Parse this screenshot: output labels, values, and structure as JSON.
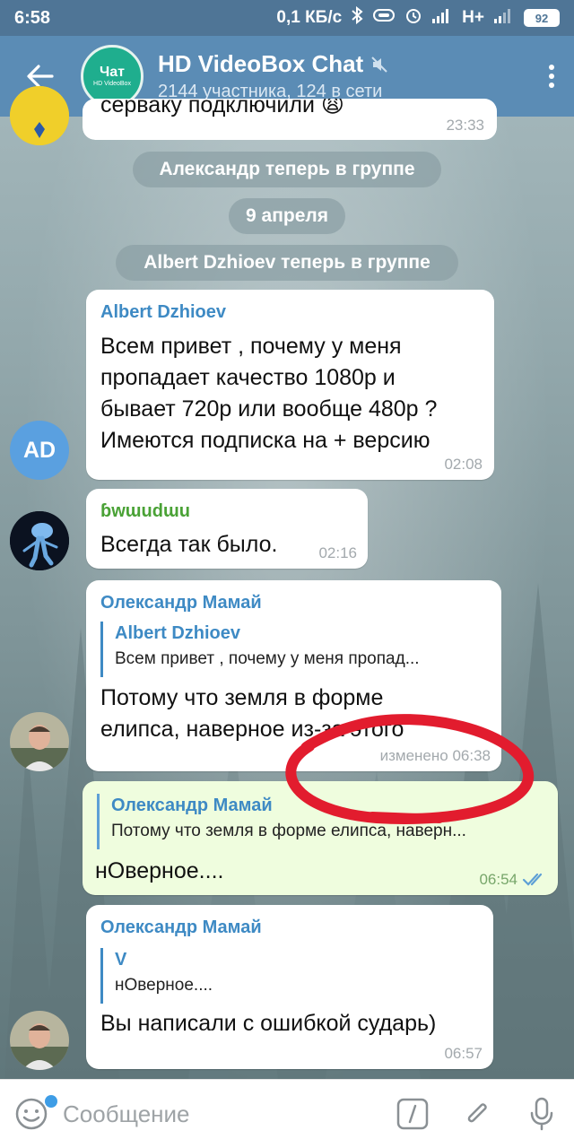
{
  "status_bar": {
    "time": "6:58",
    "network_speed": "0,1 КБ/с",
    "network_type": "H+",
    "battery": "92"
  },
  "header": {
    "avatar_title": "Чат",
    "avatar_subtitle": "HD VideoBox",
    "title": "HD VideoBox Chat",
    "subtitle": "2144 участника, 124 в сети"
  },
  "messages": {
    "partial": {
      "text": "серваку подключили 😩",
      "time": "23:33"
    },
    "service_joined_1": "Александр теперь в группе",
    "date_divider": "9 апреля",
    "service_joined_2": "Albert Dzhioev теперь в группе",
    "m1": {
      "sender": "Albert Dzhioev",
      "avatar_initials": "AD",
      "text": "Всем привет , почему у меня\nпропадает качество 1080p и\nбывает 720p или вообще 480p ?\nИмеются подписка на + версию",
      "time": "02:08"
    },
    "m2": {
      "sender": "ɓwɯudɯu",
      "text": "Всегда так было.",
      "time": "02:16"
    },
    "m3": {
      "sender": "Олександр Мамай",
      "reply_name": "Albert Dzhioev",
      "reply_text": "Всем привет , почему у меня пропад...",
      "text": "Потому что земля в форме\nелипса, наверное из-за этого",
      "time": "изменено 06:38"
    },
    "m4": {
      "reply_name": "Олександр Мамай",
      "reply_text": "Потому что земля в форме елипса, наверн...",
      "text": "нОверное....",
      "time": "06:54"
    },
    "m5": {
      "sender": "Олександр Мамай",
      "reply_name": "V",
      "reply_text": "нОверное....",
      "text": "Вы написали с ошибкой сударь)",
      "time": "06:57"
    }
  },
  "input": {
    "placeholder": "Сообщение"
  },
  "colors": {
    "header": "#5b8cb5",
    "status_bar": "#4f7596",
    "accent": "#3e8ac4",
    "outgoing_bubble": "#effdde",
    "annotation_red": "#e21c2e"
  }
}
